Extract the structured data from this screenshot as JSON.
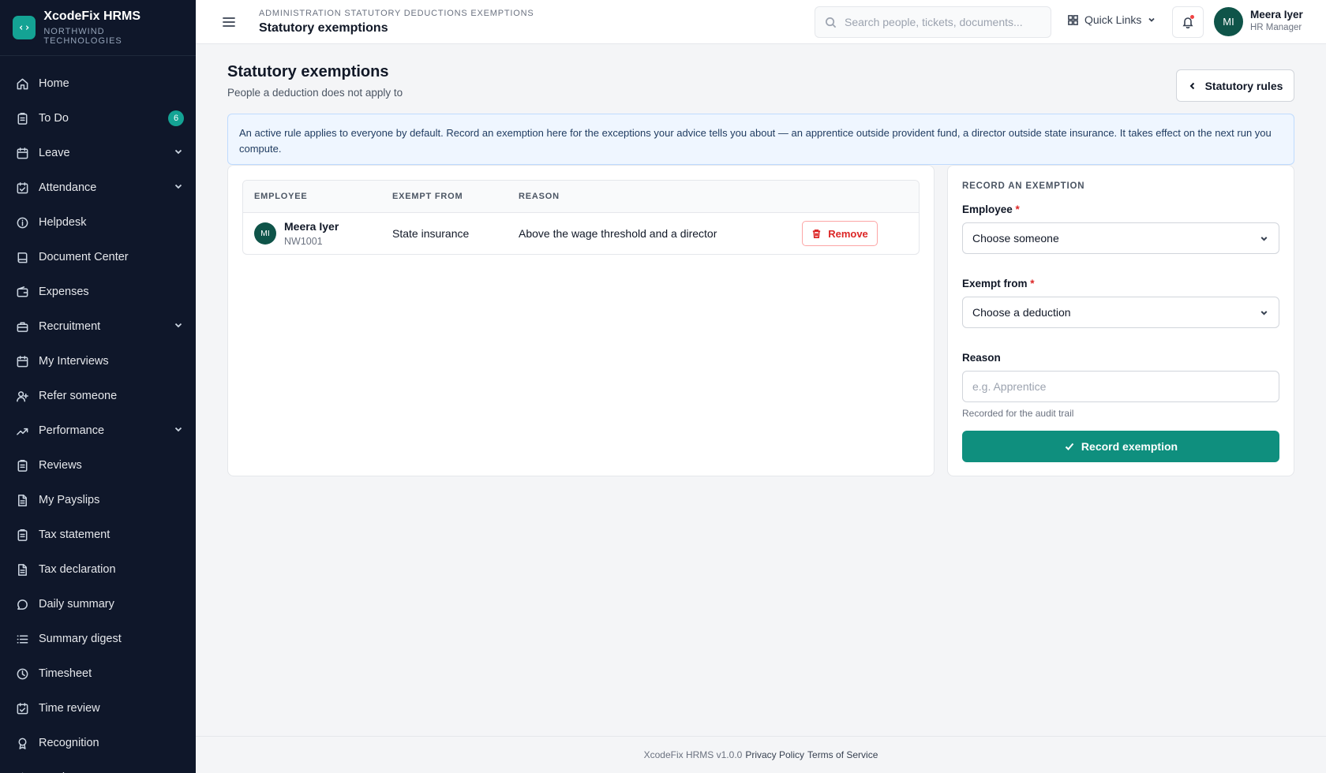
{
  "brand": {
    "logo_glyph": "‹›",
    "name": "XcodeFix HRMS",
    "org": "NORTHWIND TECHNOLOGIES"
  },
  "nav": [
    {
      "label": "Home",
      "icon": "home"
    },
    {
      "label": "To Do",
      "icon": "clipboard",
      "badge": "6"
    },
    {
      "label": "Leave",
      "icon": "calendar",
      "chevron": true
    },
    {
      "label": "Attendance",
      "icon": "calendar-check",
      "chevron": true
    },
    {
      "label": "Helpdesk",
      "icon": "info"
    },
    {
      "label": "Document Center",
      "icon": "book"
    },
    {
      "label": "Expenses",
      "icon": "wallet"
    },
    {
      "label": "Recruitment",
      "icon": "briefcase",
      "chevron": true
    },
    {
      "label": "My Interviews",
      "icon": "calendar"
    },
    {
      "label": "Refer someone",
      "icon": "user-plus"
    },
    {
      "label": "Performance",
      "icon": "trend",
      "chevron": true
    },
    {
      "label": "Reviews",
      "icon": "clipboard"
    },
    {
      "label": "My Payslips",
      "icon": "file"
    },
    {
      "label": "Tax statement",
      "icon": "clipboard"
    },
    {
      "label": "Tax declaration",
      "icon": "file"
    },
    {
      "label": "Daily summary",
      "icon": "chat"
    },
    {
      "label": "Summary digest",
      "icon": "list"
    },
    {
      "label": "Timesheet",
      "icon": "clock"
    },
    {
      "label": "Time review",
      "icon": "calendar-check"
    },
    {
      "label": "Recognition",
      "icon": "award"
    },
    {
      "label": "Feed",
      "icon": "home"
    }
  ],
  "topbar": {
    "breadcrumb": "ADMINISTRATION STATUTORY DEDUCTIONS EXEMPTIONS",
    "title": "Statutory exemptions",
    "search_placeholder": "Search people, tickets, documents...",
    "quick_links": "Quick Links",
    "user": {
      "initials": "MI",
      "name": "Meera Iyer",
      "role": "HR Manager"
    }
  },
  "page": {
    "heading": "Statutory exemptions",
    "subheading": "People a deduction does not apply to",
    "back_label": "Statutory rules",
    "info": "An active rule applies to everyone by default. Record an exemption here for the exceptions your advice tells you about — an apprentice outside provident fund, a director outside state insurance. It takes effect on the next run you compute."
  },
  "table": {
    "headers": {
      "employee": "EMPLOYEE",
      "exempt_from": "EXEMPT FROM",
      "reason": "REASON"
    },
    "rows": [
      {
        "initials": "MI",
        "name": "Meera Iyer",
        "code": "NW1001",
        "exempt_from": "State insurance",
        "reason": "Above the wage threshold and a director",
        "action": "Remove"
      }
    ]
  },
  "form": {
    "title": "RECORD AN EXEMPTION",
    "employee_label": "Employee",
    "employee_value": "Choose someone",
    "exempt_label": "Exempt from",
    "exempt_value": "Choose a deduction",
    "required_mark": "*",
    "reason_label": "Reason",
    "reason_placeholder": "e.g. Apprentice",
    "reason_hint": "Recorded for the audit trail",
    "submit_label": "Record exemption"
  },
  "footer": {
    "version": "XcodeFix HRMS v1.0.0",
    "privacy": "Privacy Policy",
    "terms": "Terms of Service"
  },
  "colors": {
    "accent": "#14a394",
    "sidebar_bg": "#0f172a",
    "danger": "#dc2626",
    "submit": "#0f8f7e"
  }
}
